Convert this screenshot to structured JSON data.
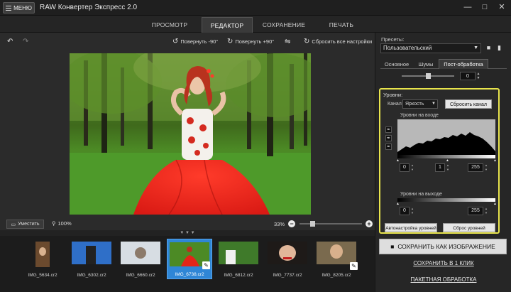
{
  "window": {
    "menu_label": "МЕНЮ",
    "title": "RAW Конвертер Экспресс 2.0",
    "controls": [
      "—",
      "□",
      "✕"
    ]
  },
  "main_tabs": [
    {
      "label": "ПРОСМОТР",
      "active": false
    },
    {
      "label": "РЕДАКТОР",
      "active": true
    },
    {
      "label": "СОХРАНЕНИЕ",
      "active": false
    },
    {
      "label": "ПЕЧАТЬ",
      "active": false
    }
  ],
  "toolbar": {
    "undo_icon": "undo-icon",
    "redo_icon": "redo-icon",
    "rotate_left": "Повернуть -90°",
    "rotate_right": "Повернуть +90°",
    "flip_icon": "flip-icon",
    "reset_all": "Сбросить все настройки"
  },
  "zoom": {
    "fit_label": "Уместить",
    "actual_label": "100%",
    "current": "33%",
    "level": 0.33
  },
  "filmstrip": {
    "collapse_arrows": "▼ ▼ ▼",
    "items": [
      {
        "name": "IMG_5634.cr2",
        "active": false,
        "edited": false
      },
      {
        "name": "IMG_6302.cr2",
        "active": false,
        "edited": false
      },
      {
        "name": "IMG_6660.cr2",
        "active": false,
        "edited": false
      },
      {
        "name": "IMG_6738.cr2",
        "active": true,
        "edited": true
      },
      {
        "name": "IMG_6812.cr2",
        "active": false,
        "edited": false
      },
      {
        "name": "IMG_7737.cr2",
        "active": false,
        "edited": false
      },
      {
        "name": "IMG_8205.cr2",
        "active": false,
        "edited": true
      }
    ]
  },
  "panel": {
    "presets_label": "Пресеты:",
    "preset_value": "Пользовательский",
    "tabs": [
      {
        "label": "Основное",
        "active": false
      },
      {
        "label": "Шумы",
        "active": false
      },
      {
        "label": "Пост-обработка",
        "active": true
      }
    ],
    "slider_value": "0",
    "levels": {
      "title": "Уровни:",
      "channel_label": "Канал",
      "channel_value": "Яркость",
      "reset_channel": "Сбросить канал",
      "input_label": "Уровни на входе",
      "input_values": {
        "black": "0",
        "mid": "1",
        "white": "255"
      },
      "output_label": "Уровни на выходе",
      "output_values": {
        "black": "0",
        "white": "255"
      },
      "auto_button": "Автонастройка уровней",
      "reset_button": "Сброс уровней"
    },
    "save_image": "СОХРАНИТЬ КАК ИЗОБРАЖЕНИЕ",
    "save_oneclick": "СОХРАНИТЬ В 1 КЛИК",
    "batch": "ПАКЕТНАЯ ОБРАБОТКА"
  },
  "colors": {
    "accent_blue": "#2f86d6",
    "highlight_yellow": "#e8e44c"
  }
}
